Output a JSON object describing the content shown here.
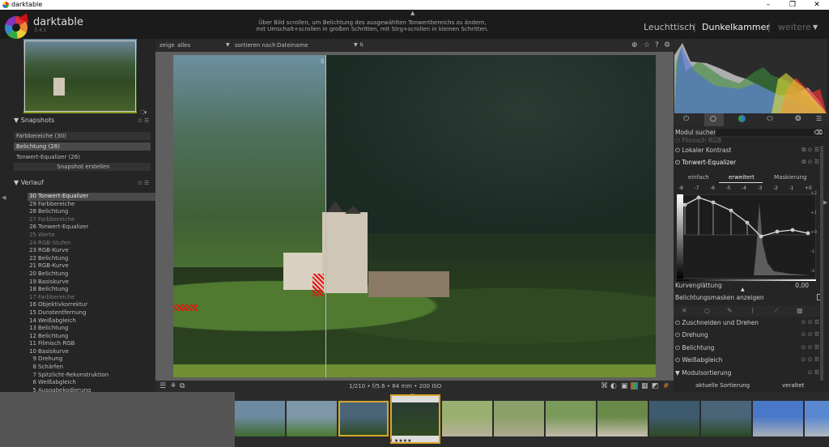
{
  "window": {
    "title": "darktable",
    "controls": [
      "–",
      "❐",
      "✕"
    ]
  },
  "header": {
    "brand": "darktable",
    "version": "3.4.1",
    "hint_line1": "Über Bild scrollen, um Belichtung des ausgewählten Tonwertbereichs zu ändern,",
    "hint_line2": "mit Umschalt+scrollen in großen Schritten, mit Strg+scrollen in kleinen Schritten.",
    "views": {
      "lighttable": "Leuchttisch",
      "darkroom": "Dunkelkammer",
      "other": "weitere"
    }
  },
  "toolbar": {
    "show_label": "zeige",
    "show_value": "alles",
    "sort_label": "sortieren nach",
    "sort_value": "Dateiname"
  },
  "snapshots": {
    "title": "Snapshots",
    "items": [
      "Farbbereiche (30)",
      "Belichtung (28)",
      "Tonwert-Equalizer (26)"
    ],
    "button": "Snapshot erstellen"
  },
  "history": {
    "title": "Verlauf",
    "items": [
      {
        "n": "30",
        "label": "Tonwert-Equalizer",
        "dim": false
      },
      {
        "n": "29",
        "label": "Farbbereiche",
        "dim": false
      },
      {
        "n": "28",
        "label": "Belichtung",
        "dim": false
      },
      {
        "n": "27",
        "label": "Farbbereiche",
        "dim": true
      },
      {
        "n": "26",
        "label": "Tonwert-Equalizer",
        "dim": false
      },
      {
        "n": "25",
        "label": "Werte",
        "dim": true
      },
      {
        "n": "24",
        "label": "RGB-Stufen",
        "dim": true
      },
      {
        "n": "23",
        "label": "RGB-Kurve",
        "dim": false
      },
      {
        "n": "22",
        "label": "Belichtung",
        "dim": false
      },
      {
        "n": "21",
        "label": "RGB-Kurve",
        "dim": false
      },
      {
        "n": "20",
        "label": "Belichtung",
        "dim": false
      },
      {
        "n": "19",
        "label": "Basiskurve",
        "dim": false
      },
      {
        "n": "18",
        "label": "Belichtung",
        "dim": false
      },
      {
        "n": "17",
        "label": "Farbbereiche",
        "dim": true
      },
      {
        "n": "16",
        "label": "Objektivkorrektur",
        "dim": false
      },
      {
        "n": "15",
        "label": "Dunstentfernung",
        "dim": false
      },
      {
        "n": "14",
        "label": "Weißabgleich",
        "dim": false
      },
      {
        "n": "13",
        "label": "Belichtung",
        "dim": false
      },
      {
        "n": "12",
        "label": "Belichtung",
        "dim": false
      },
      {
        "n": "11",
        "label": "Filmisch RGB",
        "dim": false
      },
      {
        "n": "10",
        "label": "Basiskurve",
        "dim": false
      },
      {
        "n": "9",
        "label": "Drehung",
        "dim": false
      },
      {
        "n": "8",
        "label": "Schärfen",
        "dim": false
      },
      {
        "n": "7",
        "label": "Spitzlicht-Rekonstruktion",
        "dim": false
      },
      {
        "n": "6",
        "label": "Weißabgleich",
        "dim": false
      },
      {
        "n": "5",
        "label": "Ausgabekodierung",
        "dim": false
      }
    ]
  },
  "image_info": "1/210 • f/5.6 • 84 mm • 200 ISO",
  "rightpanel": {
    "search_label": "Modul suchen",
    "modules_top": [
      "Filmisch RGB",
      "Lokaler Kontrast",
      "Tonwert-Equalizer"
    ],
    "tabs": [
      "einfach",
      "erweitert",
      "Maskierung"
    ],
    "ev_ticks": [
      "-8",
      "-7",
      "-6",
      "-5",
      "-4",
      "-3",
      "-2",
      "-1",
      "+0"
    ],
    "right_ticks": [
      "+2",
      "+1",
      "+0",
      "-1",
      "-2"
    ],
    "curve_smoothing_label": "Kurvenglättung",
    "curve_smoothing_value": "0,00",
    "show_masks": "Belichtungsmasken anzeigen",
    "modules_bottom": [
      "Zuschneiden und Drehen",
      "Drehung",
      "Belichtung",
      "Weißabgleich"
    ],
    "module_sort": "Modulsortierung",
    "current_sort": "aktuelle Sortierung",
    "outdated": "veraltet"
  },
  "filmstrip": {
    "rating": "✕ ★★★★"
  }
}
